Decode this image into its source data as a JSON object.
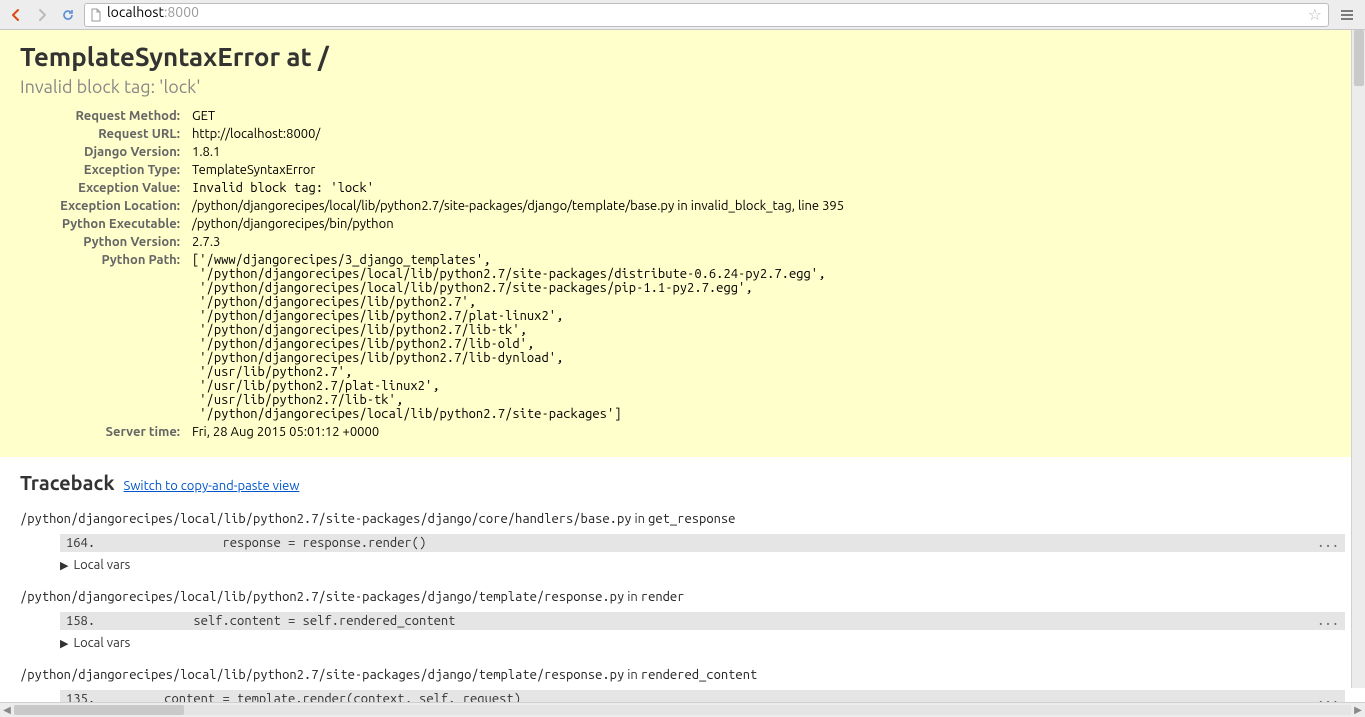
{
  "browser": {
    "url_host": "localhost",
    "url_port": ":8000"
  },
  "error": {
    "title": "TemplateSyntaxError at /",
    "subtitle": "Invalid block tag: 'lock'",
    "rows": {
      "request_method": {
        "label": "Request Method:",
        "value": "GET"
      },
      "request_url": {
        "label": "Request URL:",
        "value": "http://localhost:8000/"
      },
      "django_version": {
        "label": "Django Version:",
        "value": "1.8.1"
      },
      "exception_type": {
        "label": "Exception Type:",
        "value": "TemplateSyntaxError"
      },
      "exception_value": {
        "label": "Exception Value:",
        "value": "Invalid block tag: 'lock'"
      },
      "exception_location": {
        "label": "Exception Location:",
        "value": "/python/djangorecipes/local/lib/python2.7/site-packages/django/template/base.py in invalid_block_tag, line 395"
      },
      "python_executable": {
        "label": "Python Executable:",
        "value": "/python/djangorecipes/bin/python"
      },
      "python_version": {
        "label": "Python Version:",
        "value": "2.7.3"
      },
      "python_path": {
        "label": "Python Path:",
        "value": "['/www/djangorecipes/3_django_templates',\n '/python/djangorecipes/local/lib/python2.7/site-packages/distribute-0.6.24-py2.7.egg',\n '/python/djangorecipes/local/lib/python2.7/site-packages/pip-1.1-py2.7.egg',\n '/python/djangorecipes/lib/python2.7',\n '/python/djangorecipes/lib/python2.7/plat-linux2',\n '/python/djangorecipes/lib/python2.7/lib-tk',\n '/python/djangorecipes/lib/python2.7/lib-old',\n '/python/djangorecipes/lib/python2.7/lib-dynload',\n '/usr/lib/python2.7',\n '/usr/lib/python2.7/plat-linux2',\n '/usr/lib/python2.7/lib-tk',\n '/python/djangorecipes/local/lib/python2.7/site-packages']"
      },
      "server_time": {
        "label": "Server time:",
        "value": "Fri, 28 Aug 2015 05:01:12 +0000"
      }
    }
  },
  "traceback": {
    "heading": "Traceback",
    "switch_link": "Switch to copy-and-paste view",
    "in_word": " in ",
    "local_vars": "Local vars",
    "dots": "...",
    "frames": [
      {
        "file": "/python/djangorecipes/local/lib/python2.7/site-packages/django/core/handlers/base.py",
        "func": "get_response",
        "lineno": "164.",
        "code": "                response = response.render()"
      },
      {
        "file": "/python/djangorecipes/local/lib/python2.7/site-packages/django/template/response.py",
        "func": "render",
        "lineno": "158.",
        "code": "            self.content = self.rendered_content"
      },
      {
        "file": "/python/djangorecipes/local/lib/python2.7/site-packages/django/template/response.py",
        "func": "rendered_content",
        "lineno": "135.",
        "code": "        content = template.render(context, self._request)"
      }
    ]
  }
}
